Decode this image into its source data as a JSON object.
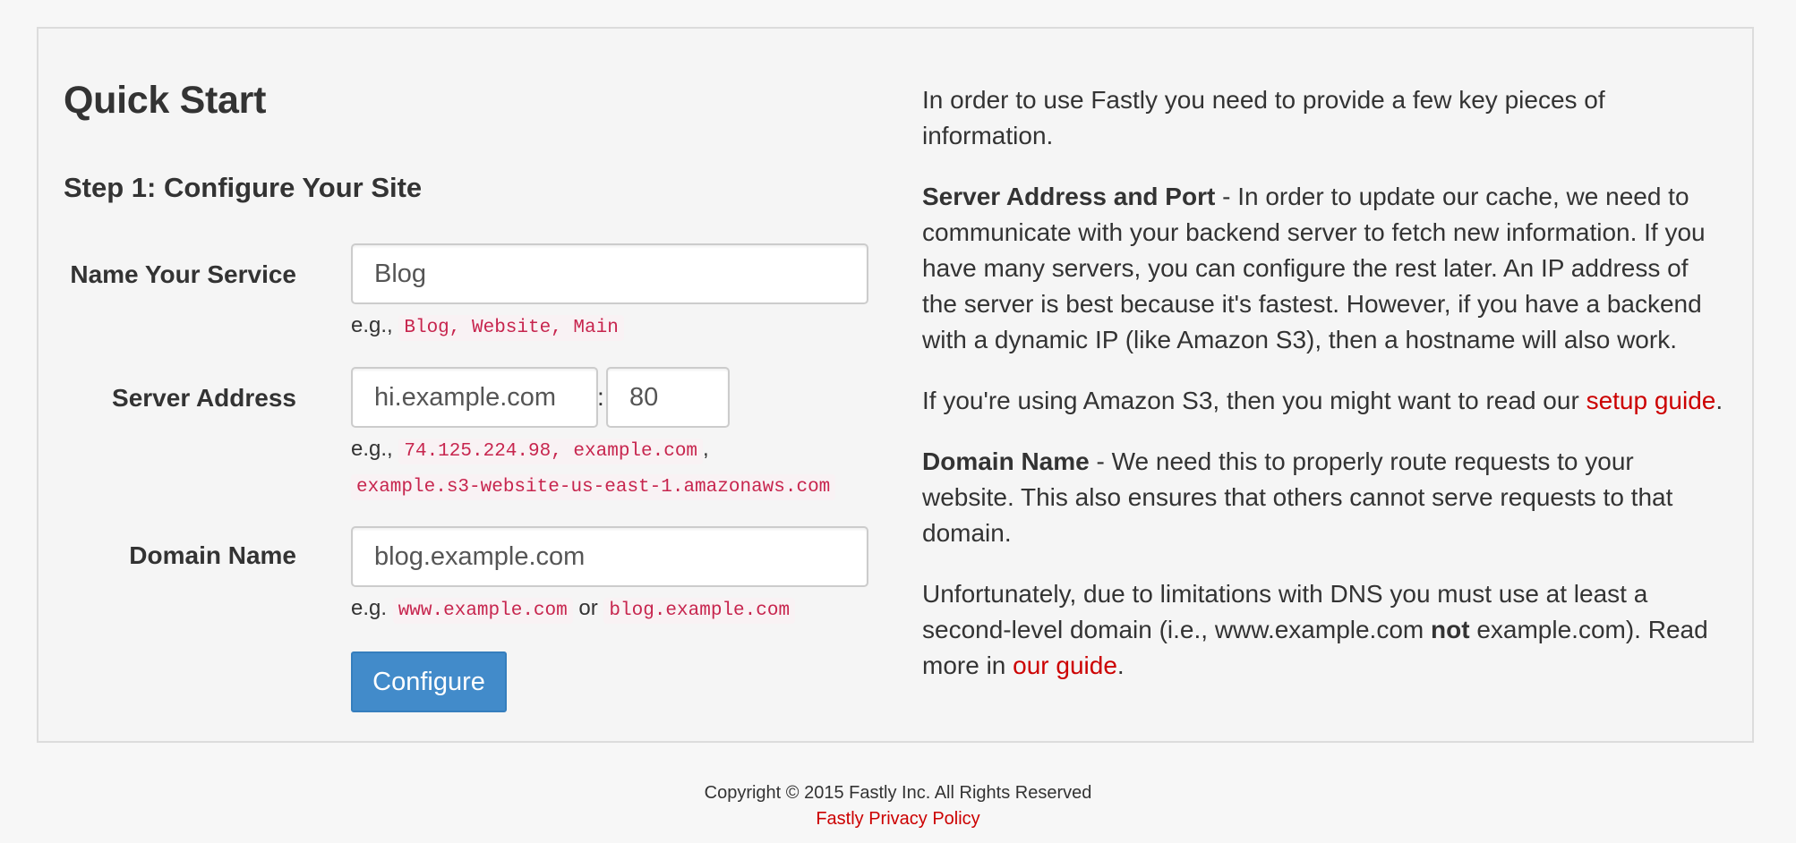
{
  "page": {
    "title": "Quick Start",
    "step_title": "Step 1: Configure Your Site"
  },
  "form": {
    "service": {
      "label": "Name Your Service",
      "placeholder": "Blog",
      "help_prefix": "e.g.,",
      "help_examples": "Blog, Website, Main"
    },
    "server": {
      "label": "Server Address",
      "address_placeholder": "hi.example.com",
      "separator": ":",
      "port_placeholder": "80",
      "help_prefix": "e.g.,",
      "example_1": "74.125.224.98, example.com",
      "separator_comma": ",",
      "example_2": "example.s3-website-us-east-1.amazonaws.com"
    },
    "domain": {
      "label": "Domain Name",
      "placeholder": "blog.example.com",
      "help_prefix": "e.g.",
      "example_1": "www.example.com",
      "or_text": "or",
      "example_2": "blog.example.com"
    },
    "submit_label": "Configure"
  },
  "info": {
    "intro": "In order to use Fastly you need to provide a few key pieces of information.",
    "server_heading": "Server Address and Port",
    "server_text": " - In order to update our cache, we need to communicate with your backend server to fetch new information. If you have many servers, you can configure the rest later. An IP address of the server is best because it's fastest. However, if you have a backend with a dynamic IP (like Amazon S3), then a hostname will also work.",
    "s3_text": "If you're using Amazon S3, then you might want to read our ",
    "s3_link": "setup guide",
    "s3_end": ".",
    "domain_heading": "Domain Name",
    "domain_text": " - We need this to properly route requests to your website. This also ensures that others cannot serve requests to that domain.",
    "dns_text_1": "Unfortunately, due to limitations with DNS you must use at least a second-level domain (i.e., www.example.com ",
    "dns_not": "not",
    "dns_text_2": " example.com). Read more in ",
    "dns_link": "our guide",
    "dns_end": "."
  },
  "footer": {
    "copyright": "Copyright © 2015 Fastly Inc. All Rights Reserved",
    "privacy_link": "Fastly Privacy Policy"
  },
  "colors": {
    "primary_button": "#428bca",
    "link": "#cc0000",
    "code_text": "#c7254e",
    "code_bg": "#f9f2f4",
    "panel_bg": "#f5f5f5",
    "page_bg": "#f7f7f7"
  }
}
